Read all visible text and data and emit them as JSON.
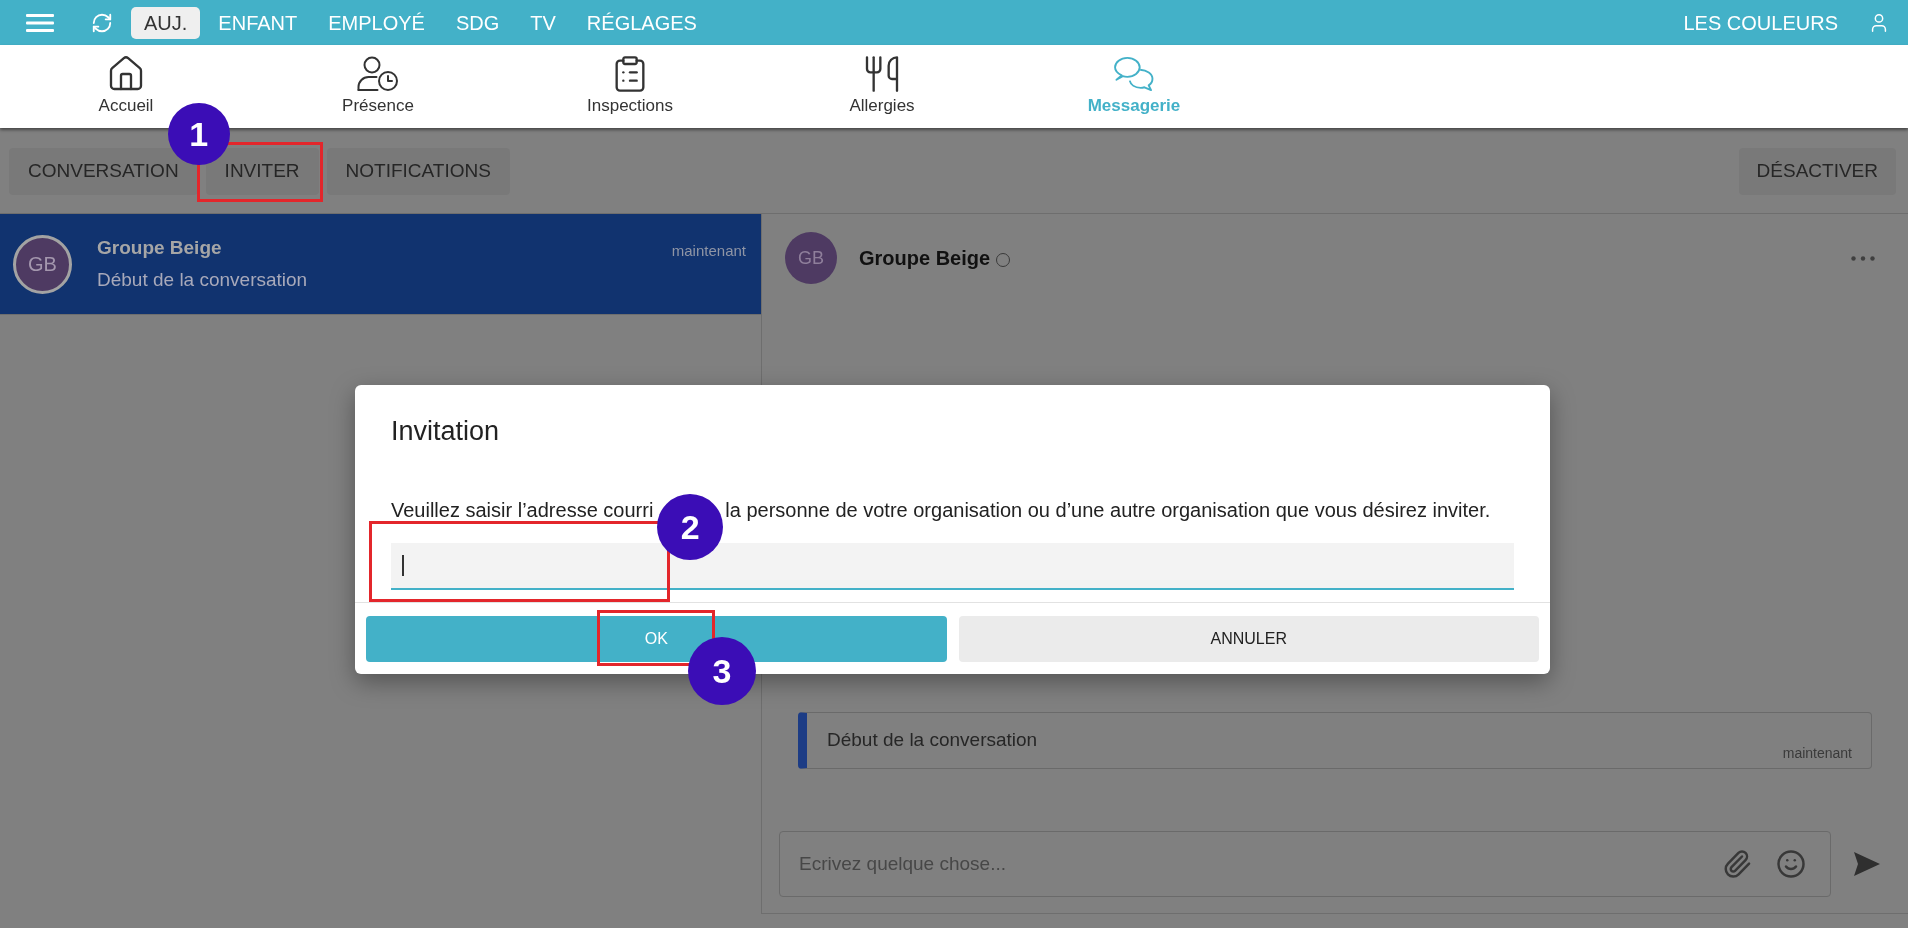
{
  "top_bar": {
    "menu_items": [
      {
        "label": "AUJ.",
        "selected": true
      },
      {
        "label": "ENFANT",
        "selected": false
      },
      {
        "label": "EMPLOYÉ",
        "selected": false
      },
      {
        "label": "SDG",
        "selected": false
      },
      {
        "label": "TV",
        "selected": false
      },
      {
        "label": "RÉGLAGES",
        "selected": false
      }
    ],
    "account": "LES COULEURS"
  },
  "module_nav": [
    {
      "kind": "home",
      "label": "Accueil",
      "selected": false
    },
    {
      "kind": "attendance",
      "label": "Présence",
      "selected": false
    },
    {
      "kind": "checklist",
      "label": "Inspections",
      "selected": false
    },
    {
      "kind": "meals",
      "label": "Allergies",
      "selected": false
    },
    {
      "kind": "messages",
      "label": "Messagerie",
      "selected": true
    }
  ],
  "toolbar": {
    "buttons": [
      {
        "label": "CONVERSATION"
      },
      {
        "label": "INVITER",
        "callout": "1"
      },
      {
        "label": "NOTIFICATIONS"
      }
    ],
    "deactivate": "DÉSACTIVER"
  },
  "conversations": [
    {
      "initials": "GB",
      "name": "Groupe Beige",
      "preview": "Début de la conversation",
      "time": "maintenant",
      "selected": true
    }
  ],
  "chat": {
    "initials": "GB",
    "name": "Groupe Beige",
    "online": false,
    "messages": [
      {
        "text": "Début de la conversation",
        "time": "maintenant"
      }
    ],
    "composer": {
      "placeholder": "Ecrivez quelque chose..."
    }
  },
  "dialog": {
    "title": "Invitation",
    "message_parts": [
      "Veuillez saisir l’adresse courri",
      "la personne de votre organisation ou d’une autre organisation que vous désirez inviter."
    ],
    "field": {
      "focused": true,
      "callout": "2"
    },
    "buttons": [
      {
        "kind": "primary",
        "label": "OK",
        "callout": "3"
      },
      {
        "kind": "secondary",
        "label": "ANNULER"
      }
    ]
  }
}
